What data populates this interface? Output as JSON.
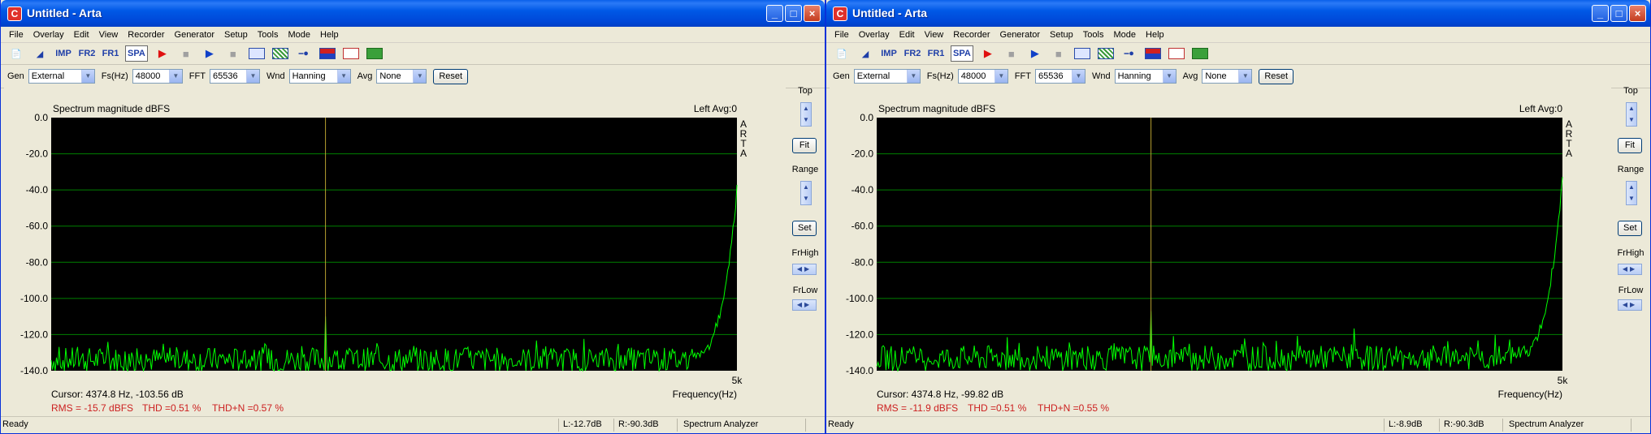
{
  "app_icon_glyph": "C",
  "menus": [
    "File",
    "Overlay",
    "Edit",
    "View",
    "Recorder",
    "Generator",
    "Setup",
    "Tools",
    "Mode",
    "Help"
  ],
  "toolbar": {
    "imp": "IMP",
    "fr2": "FR2",
    "fr1": "FR1",
    "spa": "SPA",
    "icons": [
      "new-file-icon",
      "open-file-icon",
      "record-play-icon",
      "stop-icon",
      "generator-play-icon",
      "generator-stop-icon",
      "abc-icon",
      "hatch-icon",
      "connector-icon",
      "meter-icon",
      "sine-wave-icon",
      "green-wave-icon"
    ]
  },
  "controls": {
    "gen_label": "Gen",
    "gen_value": "External",
    "fs_label": "Fs(Hz)",
    "fs_value": "48000",
    "fft_label": "FFT",
    "fft_value": "65536",
    "wnd_label": "Wnd",
    "wnd_value": "Hanning",
    "avg_label": "Avg",
    "avg_value": "None",
    "reset_label": "Reset"
  },
  "side_panel": {
    "top_label": "Top",
    "fit_label": "Fit",
    "range_label": "Range",
    "set_label": "Set",
    "frhigh_label": "FrHigh",
    "frlow_label": "FrLow"
  },
  "colors": {
    "plot_bg": "#000000",
    "grid": "#008000",
    "trace": "#00ff00",
    "cursor": "#b8a030",
    "measure_text": "#cc2020"
  },
  "windows": [
    {
      "title": "Untitled - Arta",
      "status": {
        "ready": "Ready",
        "left": "L:-12.7dB",
        "right": "R:-90.3dB",
        "mode": "Spectrum Analyzer"
      },
      "chart_data": {
        "type": "line",
        "title": "Spectrum magnitude dBFS",
        "top_right": "Left Avg:0",
        "watermark": "ARTA",
        "xlabel": "Frequency(Hz)",
        "x_tick": "5k",
        "ylim": [
          -140,
          0
        ],
        "y_ticks": [
          "0.0",
          "-20.0",
          "-40.0",
          "-60.0",
          "-80.0",
          "-100.0",
          "-120.0",
          "-140.0"
        ],
        "grid": true,
        "noise_floor_db": -133,
        "cursor": {
          "x_frac": 0.4,
          "value_text": "Cursor:  4374.8 Hz, -103.56 dB",
          "peak_db": -110
        },
        "edge_rise_db": -40,
        "measurements": {
          "rms": "RMS = -15.7 dBFS",
          "thd": "THD =0.51 %",
          "thdn": "THD+N =0.57 %"
        }
      }
    },
    {
      "title": "Untitled - Arta",
      "status": {
        "ready": "Ready",
        "left": "L:-8.9dB",
        "right": "R:-90.3dB",
        "mode": "Spectrum Analyzer"
      },
      "chart_data": {
        "type": "line",
        "title": "Spectrum magnitude dBFS",
        "top_right": "Left Avg:0",
        "watermark": "ARTA",
        "xlabel": "Frequency(Hz)",
        "x_tick": "5k",
        "ylim": [
          -140,
          0
        ],
        "y_ticks": [
          "0.0",
          "-20.0",
          "-40.0",
          "-60.0",
          "-80.0",
          "-100.0",
          "-120.0",
          "-140.0"
        ],
        "grid": true,
        "noise_floor_db": -132,
        "cursor": {
          "x_frac": 0.4,
          "value_text": "Cursor:  4374.8 Hz, -99.82 dB",
          "peak_db": -107
        },
        "edge_rise_db": -35,
        "measurements": {
          "rms": "RMS = -11.9 dBFS",
          "thd": "THD =0.51 %",
          "thdn": "THD+N =0.55 %"
        }
      }
    }
  ]
}
